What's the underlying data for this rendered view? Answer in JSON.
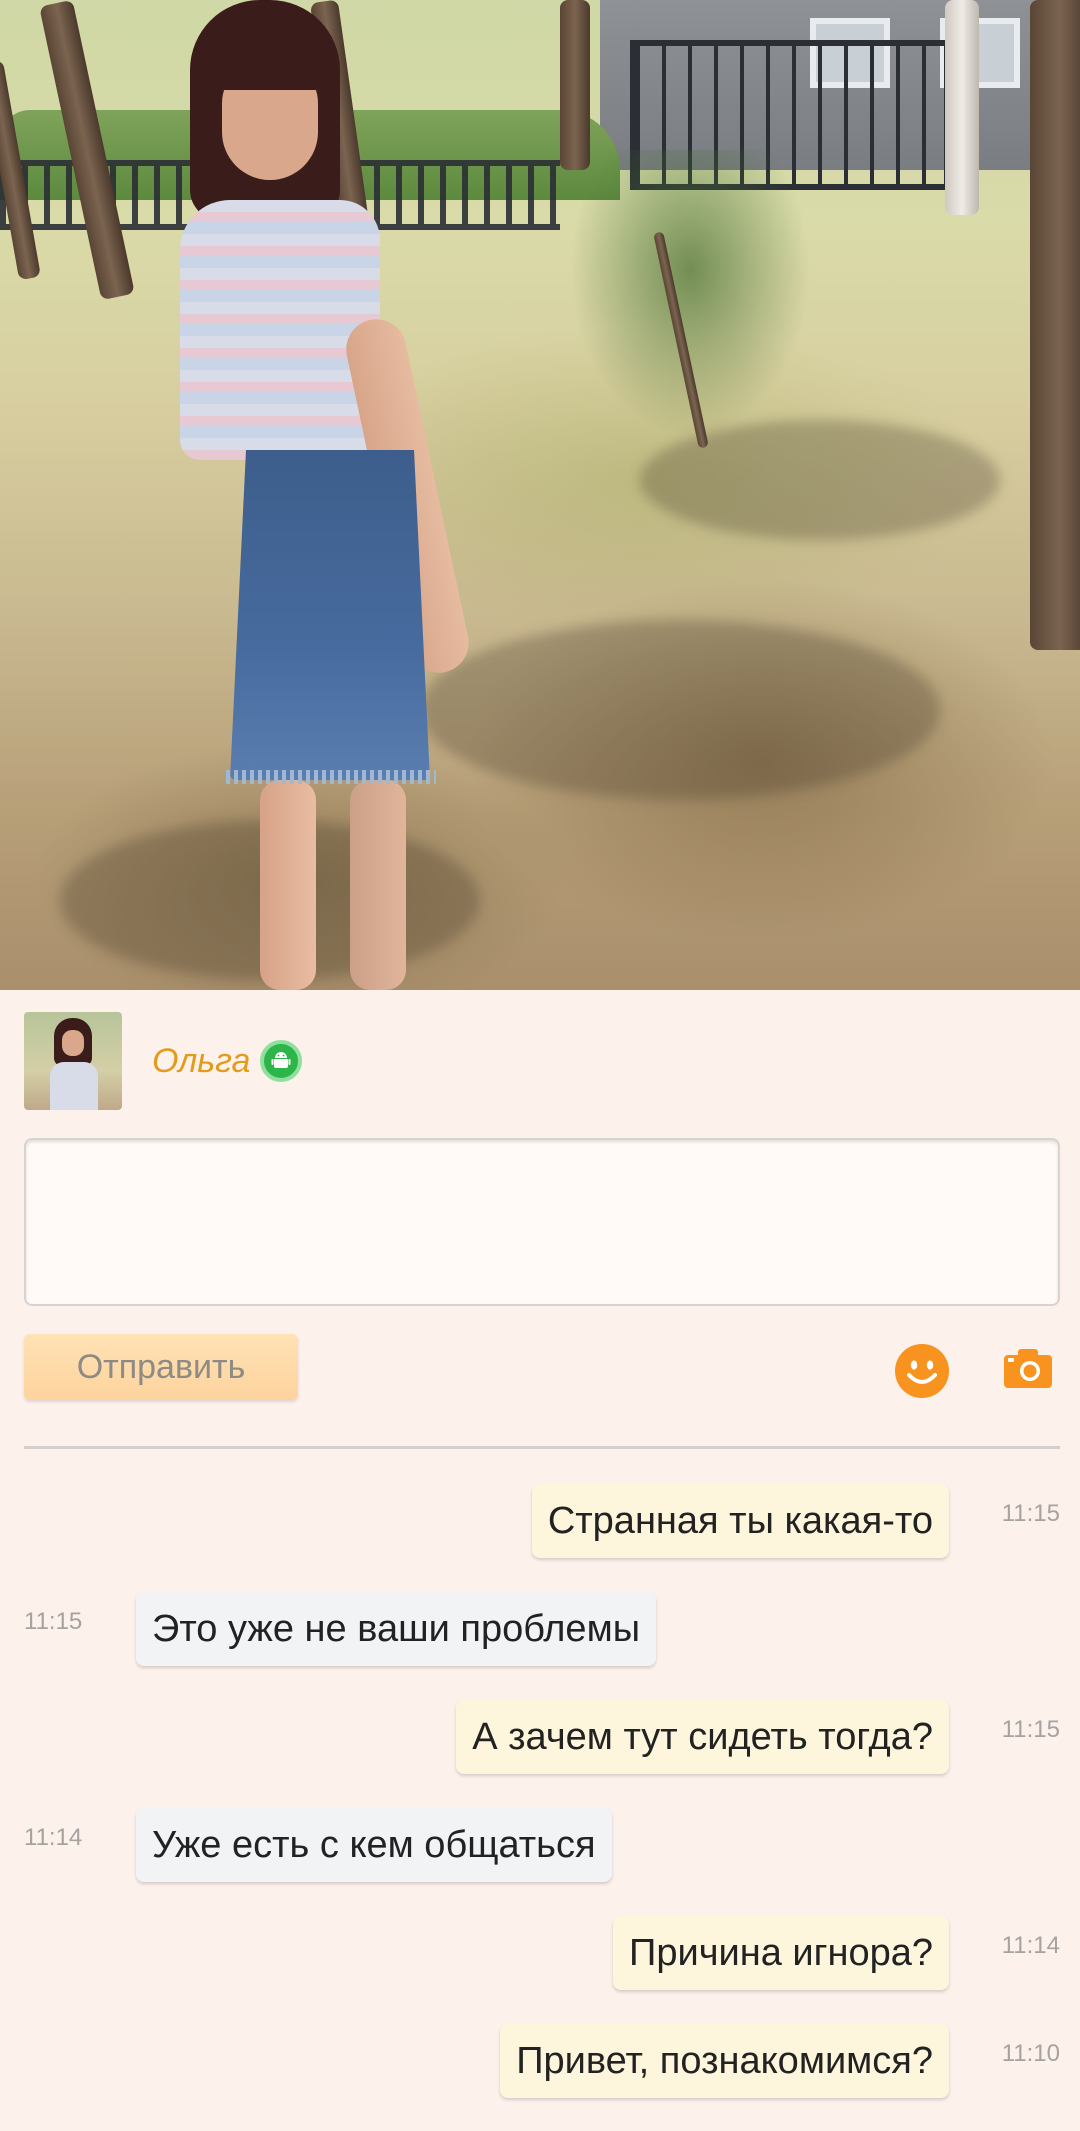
{
  "profile": {
    "name": "Ольга",
    "online_status_icon": "android-online-icon",
    "accent_color": "#e39b1c"
  },
  "composer": {
    "message_value": "",
    "send_label": "Отправить",
    "smile_icon": "smile-icon",
    "camera_icon": "camera-icon"
  },
  "messages": [
    {
      "direction": "out",
      "text": "Странная ты какая-то",
      "time": "11:15"
    },
    {
      "direction": "in",
      "text": "Это уже не ваши проблемы",
      "time": "11:15"
    },
    {
      "direction": "out",
      "text": "А зачем тут сидеть тогда?",
      "time": "11:15"
    },
    {
      "direction": "in",
      "text": "Уже есть с кем общаться",
      "time": "11:14"
    },
    {
      "direction": "out",
      "text": "Причина игнора?",
      "time": "11:14"
    },
    {
      "direction": "out",
      "text": "Привет, познакомимся?",
      "time": "11:10"
    }
  ]
}
